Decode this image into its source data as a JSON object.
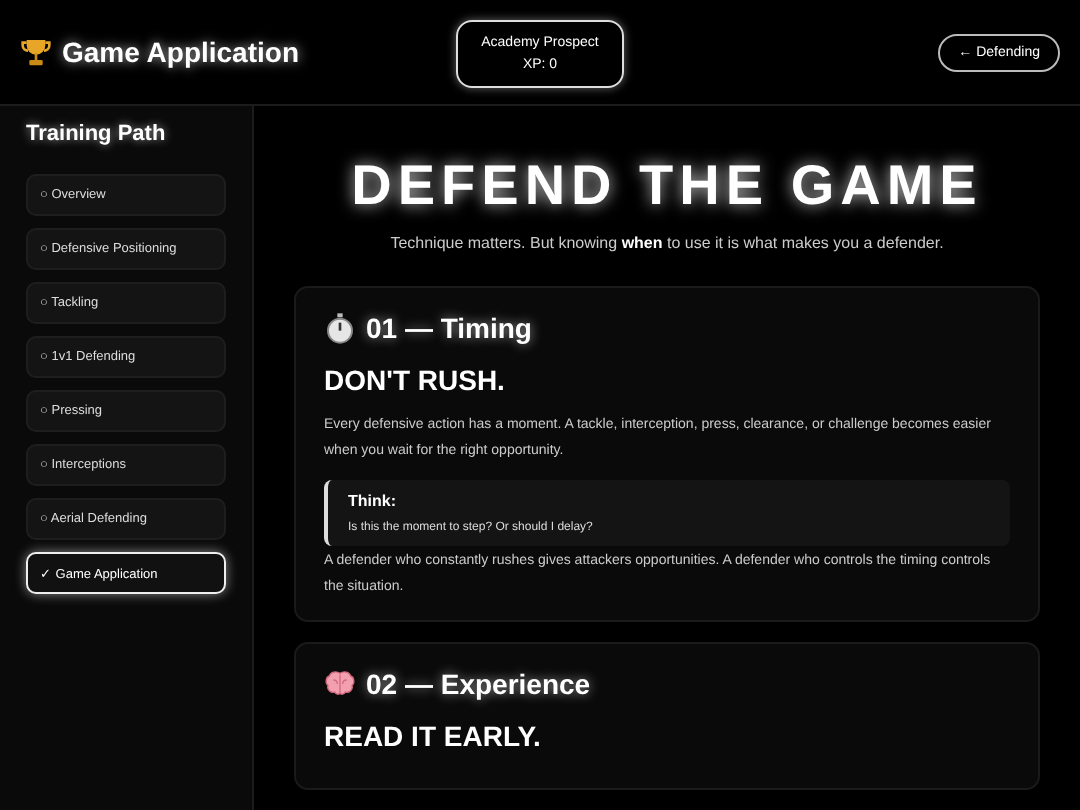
{
  "header": {
    "title": "Game Application",
    "status": {
      "rank": "Academy Prospect",
      "xp": "XP: 0"
    },
    "back_button": "← Defending"
  },
  "sidebar": {
    "title": "Training Path",
    "items": [
      {
        "marker": "○",
        "label": "Overview",
        "selected": false
      },
      {
        "marker": "○",
        "label": "Defensive Positioning",
        "selected": false
      },
      {
        "marker": "○",
        "label": "Tackling",
        "selected": false
      },
      {
        "marker": "○",
        "label": "1v1 Defending",
        "selected": false
      },
      {
        "marker": "○",
        "label": "Pressing",
        "selected": false
      },
      {
        "marker": "○",
        "label": "Interceptions",
        "selected": false
      },
      {
        "marker": "○",
        "label": "Aerial Defending",
        "selected": false
      },
      {
        "marker": "✓",
        "label": "Game Application",
        "selected": true
      }
    ]
  },
  "main": {
    "heading": "DEFEND THE GAME",
    "intro": "Technique matters. But knowing **when** to use it is what makes you a defender.",
    "cards": [
      {
        "kind": "stopwatch",
        "title": "01 — Timing",
        "headline": "DON'T RUSH.",
        "paragraphs": [
          "Every defensive action has a moment. A tackle, interception, press, clearance, or challenge becomes easier when you wait for the right opportunity.",
          "A defender who constantly rushes gives attackers opportunities. A defender who controls the timing controls the situation."
        ],
        "callout": {
          "title": "Think:",
          "text": "Is this the moment to step? Or should I delay?"
        }
      },
      {
        "kind": "brain",
        "title": "02 — Experience",
        "headline": "READ IT EARLY."
      }
    ]
  }
}
